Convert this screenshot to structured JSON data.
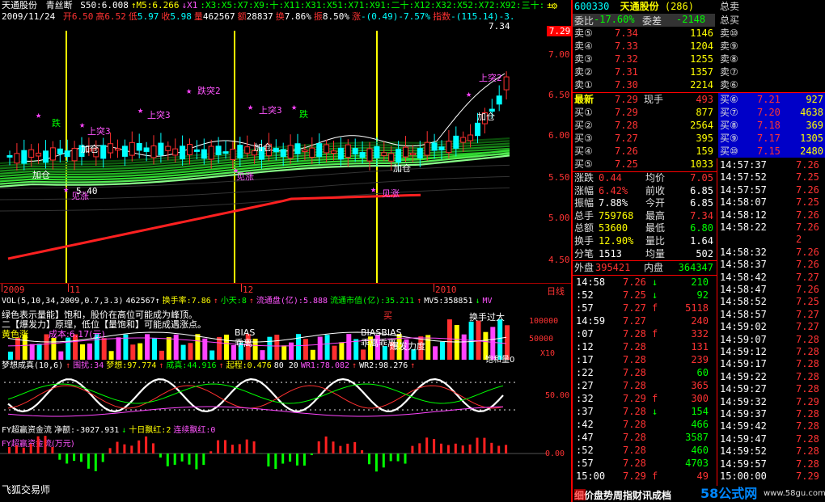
{
  "header": {
    "stock_name": "天通股份",
    "indicator_name": "青丝断",
    "params": [
      {
        "text": "S50:6.008",
        "color": "#ffffff"
      },
      {
        "text": "↑M5:6.266",
        "color": "#ffff00"
      },
      {
        "text": "↓X1",
        "color": "#ff55ff"
      },
      {
        "text": ":X3:X5:X7:X9:十:X11:X31:X51:X71:X91:二十:X12:X32:X52:X72:X92:三十:",
        "color": "#00ff00"
      },
      {
        "text": "±",
        "color": "#ffff00"
      }
    ],
    "settings_icon_label": "⚙"
  },
  "ohlc_bar": {
    "date": "2009/11/24",
    "items": [
      {
        "label": "开",
        "value": "6.50",
        "color": "#ff3333"
      },
      {
        "label": "高",
        "value": "6.52",
        "color": "#ff3333"
      },
      {
        "label": "低",
        "value": "5.97",
        "color": "#00ffff"
      },
      {
        "label": "收",
        "value": "5.98",
        "color": "#00ffff"
      },
      {
        "label": "量",
        "value": "462567",
        "color": "#ffffff"
      },
      {
        "label": "额",
        "value": "28837",
        "color": "#ffffff"
      },
      {
        "label": "换",
        "value": "7.86%",
        "color": "#ffffff"
      },
      {
        "label": "振",
        "value": "8.50%",
        "color": "#ffffff"
      },
      {
        "label": "涨",
        "value": "-(0.49)-7.57%",
        "color": "#00ffff"
      },
      {
        "label": "指数",
        "value": "-(115.14)-3.",
        "color": "#00ffff"
      }
    ]
  },
  "price_axis": {
    "current_price": "7.29",
    "ticks": [
      "7.00",
      "6.50",
      "6.00",
      "5.50",
      "5.00",
      "4.50"
    ],
    "top_value": "7.34"
  },
  "price_annotations": [
    {
      "text": "跌",
      "color": "#00ff00"
    },
    {
      "text": "跌突2",
      "color": "#ff55ff"
    },
    {
      "text": "上突3",
      "color": "#ff55ff"
    },
    {
      "text": "上突3",
      "color": "#ff55ff"
    },
    {
      "text": "上突3",
      "color": "#ff55ff"
    },
    {
      "text": "跌",
      "color": "#00ff00"
    },
    {
      "text": "加仓",
      "color": "#ffffff"
    },
    {
      "text": "加仓",
      "color": "#ffffff"
    },
    {
      "text": "加仓",
      "color": "#ffffff"
    },
    {
      "text": "加仓",
      "color": "#ffffff"
    },
    {
      "text": "加仓",
      "color": "#ffffff"
    },
    {
      "text": "见涨",
      "color": "#ff55ff"
    },
    {
      "text": "见涨",
      "color": "#ff55ff"
    },
    {
      "text": "见涨",
      "color": "#ff55ff"
    },
    {
      "text": "上突2",
      "color": "#ff55ff"
    },
    {
      "text": "5.40",
      "color": "#ffffff"
    }
  ],
  "date_axis": {
    "labels": [
      "2009",
      "11",
      "12",
      "2010"
    ],
    "period_label": "日线"
  },
  "volume_pane": {
    "header": [
      {
        "text": "VOL(5,10,34,2009,0.7,3.3)",
        "color": "#ffffff"
      },
      {
        "text": "462567↑",
        "color": "#ffffff"
      },
      {
        "text": "换手率:7.86",
        "color": "#ffff00"
      },
      {
        "text": "↑",
        "color": "#ff3333"
      },
      {
        "text": "小天:8",
        "color": "#00ff00"
      },
      {
        "text": "↑",
        "color": "#ff3333"
      },
      {
        "text": "流通盘(亿):5.888",
        "color": "#ff55ff"
      },
      {
        "text": "流通市值(亿):35.211",
        "color": "#00ff00"
      },
      {
        "text": "↑",
        "color": "#ff3333"
      },
      {
        "text": "MV5:358851",
        "color": "#ffffff"
      },
      {
        "text": "↓",
        "color": "#00ff00"
      },
      {
        "text": "MV",
        "color": "#ff55ff"
      }
    ],
    "notes": [
      {
        "text": "绿色表示量能】饱和，股价在高位可能成为峰顶。",
        "color": "#ffffff"
      },
      {
        "text": "二【爆发力】原理，低位【量饱和】可能成遇涨点。",
        "color": "#ffffff"
      },
      {
        "text": "黄色涨",
        "color": "#ffff00"
      },
      {
        "text": "成本:6.17(元)",
        "color": "#ff55ff"
      }
    ],
    "labels": [
      "BIAS",
      "乖离",
      "BIASBIAS",
      "乖离乖离",
      "爆发力度",
      "换手过大",
      "买"
    ],
    "axis": [
      "100000",
      "50000",
      "X10"
    ],
    "corner_label": "饱和量0"
  },
  "dream_pane": {
    "header": [
      {
        "text": "梦想成真(10,6)",
        "color": "#ffffff"
      },
      {
        "text": "↑",
        "color": "#ff3333"
      },
      {
        "text": "围扰:34",
        "color": "#ff55ff"
      },
      {
        "text": "梦想:97.774",
        "color": "#ffff00"
      },
      {
        "text": "↑",
        "color": "#ff3333"
      },
      {
        "text": "成真:44.916",
        "color": "#00ff00"
      },
      {
        "text": "↑",
        "color": "#ff3333"
      },
      {
        "text": "起程:0.476",
        "color": "#ffff00"
      },
      {
        "text": "80 20",
        "color": "#ffffff"
      },
      {
        "text": "WR1:78.082",
        "color": "#ff55ff"
      },
      {
        "text": "↑",
        "color": "#ff3333"
      },
      {
        "text": "WR2:98.276",
        "color": "#ffffff"
      },
      {
        "text": "↑",
        "color": "#ff3333"
      }
    ],
    "axis": [
      "50.00"
    ]
  },
  "fund_pane": {
    "header": [
      {
        "text": "FY超赢资金流",
        "color": "#ffffff"
      },
      {
        "text": "净额:-3027.931",
        "color": "#ffffff"
      },
      {
        "text": "↓",
        "color": "#00ff00"
      },
      {
        "text": "十日飘红:2",
        "color": "#ffff00"
      },
      {
        "text": "连续飘红:0",
        "color": "#ff55ff"
      }
    ],
    "sub_label": "FY超赢资金流(万元)",
    "axis": [
      "0.00"
    ],
    "watermark": "飞狐交易师"
  },
  "right_panel": {
    "code": "600330",
    "name": "天通股份",
    "count": "(286)",
    "weibi_label": "委比",
    "weibi_value": "-17.60%",
    "weicha_label": "委差",
    "weicha_value": "-2148",
    "total_sell_label": "总卖",
    "total_buy_label": "总买",
    "sell_levels": [
      {
        "label": "卖⑤",
        "price": "7.34",
        "vol": "1146"
      },
      {
        "label": "卖④",
        "price": "7.33",
        "vol": "1204"
      },
      {
        "label": "卖③",
        "price": "7.32",
        "vol": "1255"
      },
      {
        "label": "卖②",
        "price": "7.31",
        "vol": "1357"
      },
      {
        "label": "卖①",
        "price": "7.30",
        "vol": "2214"
      }
    ],
    "sell_deep_labels": [
      "卖⑩",
      "卖⑨",
      "卖⑧",
      "卖⑦",
      "卖⑥"
    ],
    "latest_label": "最新",
    "latest_price": "7.29",
    "handnow_label": "现手",
    "handnow_value": "493",
    "buy_levels": [
      {
        "label": "买①",
        "price": "7.29",
        "vol": "877"
      },
      {
        "label": "买②",
        "price": "7.28",
        "vol": "2564"
      },
      {
        "label": "买③",
        "price": "7.27",
        "vol": "395"
      },
      {
        "label": "买④",
        "price": "7.26",
        "vol": "159"
      },
      {
        "label": "买⑤",
        "price": "7.25",
        "vol": "1033"
      }
    ],
    "buy_deep": [
      {
        "label": "买⑥",
        "price": "7.21",
        "vol": "927"
      },
      {
        "label": "买⑦",
        "price": "7.20",
        "vol": "4638"
      },
      {
        "label": "买⑧",
        "price": "7.18",
        "vol": "369"
      },
      {
        "label": "买⑨",
        "price": "7.17",
        "vol": "1305"
      },
      {
        "label": "买⑩",
        "price": "7.15",
        "vol": "2480"
      }
    ],
    "stats": [
      {
        "l1": "涨跌",
        "v1": "0.44",
        "c1": "#ff3333",
        "l2": "均价",
        "v2": "7.05",
        "c2": "#ff3333"
      },
      {
        "l1": "涨幅",
        "v1": "6.42%",
        "c1": "#ff3333",
        "l2": "前收",
        "v2": "6.85",
        "c2": "#ffffff"
      },
      {
        "l1": "振幅",
        "v1": "7.88%",
        "c1": "#ffffff",
        "l2": "今开",
        "v2": "6.85",
        "c2": "#ffffff"
      },
      {
        "l1": "总手",
        "v1": "759768",
        "c1": "#ffff00",
        "l2": "最高",
        "v2": "7.34",
        "c2": "#ff3333"
      },
      {
        "l1": "总额",
        "v1": "53600",
        "c1": "#ffff00",
        "l2": "最低",
        "v2": "6.80",
        "c2": "#00ff00"
      },
      {
        "l1": "换手",
        "v1": "12.90%",
        "c1": "#ffff00",
        "l2": "量比",
        "v2": "1.64",
        "c2": "#ffffff"
      },
      {
        "l1": "分笔",
        "v1": "1513",
        "c1": "#ffffff",
        "l2": "均量",
        "v2": "502",
        "c2": "#ffffff"
      }
    ],
    "outer_label": "外盘",
    "outer_value": "395421",
    "inner_label": "内盘",
    "inner_value": "364347",
    "ticks_mid": [
      {
        "t": "14:58",
        "p": "7.26",
        "a": "↓",
        "ac": "#00ff00",
        "v": "210",
        "vc": "#00ff00"
      },
      {
        "t": ":52",
        "p": "7.25",
        "a": "↓",
        "ac": "#00ff00",
        "v": "92",
        "vc": "#00ff00"
      },
      {
        "t": ":57",
        "p": "7.27",
        "a": "f",
        "ac": "#ff3333",
        "v": "5118",
        "vc": "#ff3333"
      },
      {
        "t": "14:59",
        "p": "7.27",
        "a": "",
        "ac": "#ff3333",
        "v": "240",
        "vc": "#ff3333"
      },
      {
        "t": ":07",
        "p": "7.28",
        "a": "f",
        "ac": "#ff3333",
        "v": "332",
        "vc": "#ff3333"
      },
      {
        "t": ":12",
        "p": "7.28",
        "a": "",
        "ac": "#ff3333",
        "v": "131",
        "vc": "#ff3333"
      },
      {
        "t": ":17",
        "p": "7.28",
        "a": "",
        "ac": "#ff3333",
        "v": "239",
        "vc": "#ff3333"
      },
      {
        "t": ":22",
        "p": "7.28",
        "a": "",
        "ac": "#ff3333",
        "v": "60",
        "vc": "#00ff00"
      },
      {
        "t": ":27",
        "p": "7.28",
        "a": "",
        "ac": "#ff3333",
        "v": "365",
        "vc": "#ff3333"
      },
      {
        "t": ":32",
        "p": "7.29",
        "a": "f",
        "ac": "#ff3333",
        "v": "300",
        "vc": "#ff3333"
      },
      {
        "t": ":37",
        "p": "7.28",
        "a": "↓",
        "ac": "#00ff00",
        "v": "154",
        "vc": "#00ff00"
      },
      {
        "t": ":42",
        "p": "7.28",
        "a": "",
        "ac": "#ff3333",
        "v": "466",
        "vc": "#00ff00"
      },
      {
        "t": ":47",
        "p": "7.28",
        "a": "",
        "ac": "#ff3333",
        "v": "3587",
        "vc": "#00ff00"
      },
      {
        "t": ":52",
        "p": "7.28",
        "a": "",
        "ac": "#ff3333",
        "v": "460",
        "vc": "#00ff00"
      },
      {
        "t": ":57",
        "p": "7.28",
        "a": "",
        "ac": "#ff3333",
        "v": "4703",
        "vc": "#00ff00"
      },
      {
        "t": "15:00",
        "p": "7.29",
        "a": "f",
        "ac": "#ff3333",
        "v": "49",
        "vc": "#ff3333"
      }
    ],
    "ticks_right": [
      {
        "t": "14:57:37",
        "p": "7.26"
      },
      {
        "t": "14:57:52",
        "p": "7.25"
      },
      {
        "t": "14:57:57",
        "p": "7.26"
      },
      {
        "t": "14:58:07",
        "p": "7.25"
      },
      {
        "t": "14:58:12",
        "p": "7.26"
      },
      {
        "t": "14:58:22",
        "p": "7.26"
      },
      {
        "t": "",
        "p": "2"
      },
      {
        "t": "14:58:32",
        "p": "7.26"
      },
      {
        "t": "14:58:37",
        "p": "7.26"
      },
      {
        "t": "14:58:42",
        "p": "7.27"
      },
      {
        "t": "14:58:47",
        "p": "7.26"
      },
      {
        "t": "14:58:52",
        "p": "7.25"
      },
      {
        "t": "14:58:57",
        "p": "7.27"
      },
      {
        "t": "14:59:02",
        "p": "7.27"
      },
      {
        "t": "14:59:07",
        "p": "7.28"
      },
      {
        "t": "14:59:12",
        "p": "7.28"
      },
      {
        "t": "14:59:17",
        "p": "7.28"
      },
      {
        "t": "14:59:22",
        "p": "7.28"
      },
      {
        "t": "14:59:27",
        "p": "7.28"
      },
      {
        "t": "14:59:32",
        "p": "7.29"
      },
      {
        "t": "14:59:37",
        "p": "7.28"
      },
      {
        "t": "14:59:42",
        "p": "7.28"
      },
      {
        "t": "14:59:47",
        "p": "7.28"
      },
      {
        "t": "14:59:52",
        "p": "7.28"
      },
      {
        "t": "14:59:57",
        "p": "7.28"
      },
      {
        "t": "15:00:00",
        "p": "7.29"
      }
    ],
    "bottom_tabs": "细价盘势周指财讯成档",
    "site_logo": "58公式网",
    "site_url": "www.58gu.com"
  }
}
